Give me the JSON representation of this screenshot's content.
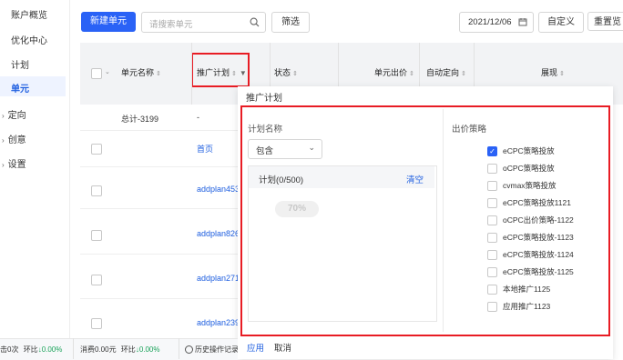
{
  "sidebar": {
    "items": [
      {
        "label": "账户概览"
      },
      {
        "label": "优化中心"
      },
      {
        "label": "计划"
      },
      {
        "label": "单元"
      },
      {
        "label": "定向"
      },
      {
        "label": "创意"
      },
      {
        "label": "设置"
      }
    ]
  },
  "toolbar": {
    "new_unit_label": "新建单元",
    "search_placeholder": "请搜索单元",
    "filter_label": "筛选",
    "date_value": "2021/12/06",
    "custom_label": "自定义",
    "reset_label": "重置览"
  },
  "table": {
    "headers": [
      "单元名称",
      "推广计划",
      "状态",
      "单元出价",
      "自动定向",
      "展现"
    ],
    "total_label": "总计-3199",
    "total_plan": "-",
    "rows": [
      {
        "plan": "首页"
      },
      {
        "plan": "addplan453"
      },
      {
        "plan": "addplan826"
      },
      {
        "plan": "addplan271"
      },
      {
        "plan": "addplan239"
      }
    ]
  },
  "filter_popup": {
    "title": "推广计划",
    "plan_name_label": "计划名称",
    "match_select": "包含",
    "plan_list_label": "计划(0/500)",
    "clear_label": "清空",
    "placeholder_pill": "70%",
    "bid_strategy_label": "出价策略",
    "strategies": [
      {
        "label": "eCPC策略投放",
        "checked": true
      },
      {
        "label": "oCPC策略投放",
        "checked": false
      },
      {
        "label": "cvmax策略投放",
        "checked": false
      },
      {
        "label": "eCPC策略投放1121",
        "checked": false
      },
      {
        "label": "oCPC出价策略-1122",
        "checked": false
      },
      {
        "label": "eCPC策略投放-1123",
        "checked": false
      },
      {
        "label": "eCPC策略投放-1124",
        "checked": false
      },
      {
        "label": "eCPC策略投放-1125",
        "checked": false
      },
      {
        "label": "本地推广1125",
        "checked": false
      },
      {
        "label": "应用推广1123",
        "checked": false
      }
    ],
    "apply_label": "应用",
    "cancel_label": "取消"
  },
  "footer": {
    "clicks": "击0次",
    "ratio1_label": "环比",
    "ratio1_value": "↓0.00%",
    "spend": "消费0.00元",
    "ratio2_label": "环比",
    "ratio2_value": "↓0.00%",
    "history_label": "历史操作记录"
  },
  "colors": {
    "accent": "#2a62f6",
    "highlight": "#e81c24",
    "link": "#1f5fe0"
  }
}
